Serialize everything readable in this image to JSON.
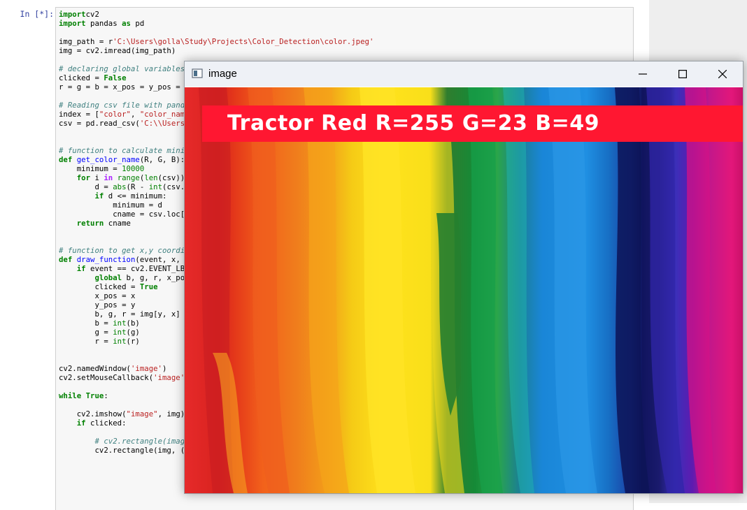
{
  "notebook": {
    "prompt": "In [*]:",
    "code_lines": [
      [
        [
          "kw",
          "import"
        ],
        [
          "",
          "cv2"
        ]
      ],
      [
        [
          "kw",
          "import"
        ],
        [
          "",
          " pandas "
        ],
        [
          "kw",
          "as"
        ],
        [
          "",
          " pd"
        ]
      ],
      [
        [
          "",
          ""
        ]
      ],
      [
        [
          "",
          "img_path = r"
        ],
        [
          "st",
          "'C:\\Users\\golla\\Study\\Projects\\Color_Detection\\color.jpeg'"
        ]
      ],
      [
        [
          "",
          "img = cv2.imread(img_path)"
        ]
      ],
      [
        [
          "",
          ""
        ]
      ],
      [
        [
          "cm",
          "# declaring global variables"
        ]
      ],
      [
        [
          "",
          "clicked = "
        ],
        [
          "kw",
          "False"
        ]
      ],
      [
        [
          "",
          "r = g = b = x_pos = y_pos = "
        ]
      ],
      [
        [
          "",
          ""
        ]
      ],
      [
        [
          "cm",
          "# Reading csv file with pand"
        ]
      ],
      [
        [
          "",
          "index = ["
        ],
        [
          "st",
          "\"color\""
        ],
        [
          "",
          ", "
        ],
        [
          "st",
          "\"color_nam"
        ]
      ],
      [
        [
          "",
          "csv = pd.read_csv("
        ],
        [
          "st",
          "'C:\\\\Users"
        ]
      ],
      [
        [
          "",
          ""
        ]
      ],
      [
        [
          "",
          ""
        ]
      ],
      [
        [
          "cm",
          "# function to calculate mini"
        ]
      ],
      [
        [
          "kw",
          "def"
        ],
        [
          "",
          " "
        ],
        [
          "fn",
          "get_color_name"
        ],
        [
          "",
          "(R, G, B):"
        ]
      ],
      [
        [
          "",
          "    minimum = "
        ],
        [
          "num",
          "10000"
        ]
      ],
      [
        [
          "",
          "    "
        ],
        [
          "kw",
          "for"
        ],
        [
          "",
          " i "
        ],
        [
          "op",
          "in"
        ],
        [
          "",
          " "
        ],
        [
          "nm",
          "range"
        ],
        [
          "",
          "("
        ],
        [
          "nm",
          "len"
        ],
        [
          "",
          "(csv))"
        ]
      ],
      [
        [
          "",
          "        d = "
        ],
        [
          "nm",
          "abs"
        ],
        [
          "",
          "(R - "
        ],
        [
          "nm",
          "int"
        ],
        [
          "",
          "(csv."
        ]
      ],
      [
        [
          "",
          "        "
        ],
        [
          "kw",
          "if"
        ],
        [
          "",
          " d <= minimum:"
        ]
      ],
      [
        [
          "",
          "            minimum = d"
        ]
      ],
      [
        [
          "",
          "            cname = csv.loc["
        ]
      ],
      [
        [
          "",
          "    "
        ],
        [
          "kw",
          "return"
        ],
        [
          "",
          " cname"
        ]
      ],
      [
        [
          "",
          ""
        ]
      ],
      [
        [
          "",
          ""
        ]
      ],
      [
        [
          "cm",
          "# function to get x,y coordi"
        ]
      ],
      [
        [
          "kw",
          "def"
        ],
        [
          "",
          " "
        ],
        [
          "fn",
          "draw_function"
        ],
        [
          "",
          "(event, x,"
        ]
      ],
      [
        [
          "",
          "    "
        ],
        [
          "kw",
          "if"
        ],
        [
          "",
          " event == cv2.EVENT_LB"
        ]
      ],
      [
        [
          "",
          "        "
        ],
        [
          "kw",
          "global"
        ],
        [
          "",
          " b, g, r, x_po"
        ]
      ],
      [
        [
          "",
          "        clicked = "
        ],
        [
          "kw",
          "True"
        ]
      ],
      [
        [
          "",
          "        x_pos = x"
        ]
      ],
      [
        [
          "",
          "        y_pos = y"
        ]
      ],
      [
        [
          "",
          "        b, g, r = img[y, x]"
        ]
      ],
      [
        [
          "",
          "        b = "
        ],
        [
          "nm",
          "int"
        ],
        [
          "",
          "(b)"
        ]
      ],
      [
        [
          "",
          "        g = "
        ],
        [
          "nm",
          "int"
        ],
        [
          "",
          "(g)"
        ]
      ],
      [
        [
          "",
          "        r = "
        ],
        [
          "nm",
          "int"
        ],
        [
          "",
          "(r)"
        ]
      ],
      [
        [
          "",
          ""
        ]
      ],
      [
        [
          "",
          ""
        ]
      ],
      [
        [
          "",
          "cv2.namedWindow("
        ],
        [
          "st",
          "'image'"
        ],
        [
          "",
          ")"
        ]
      ],
      [
        [
          "",
          "cv2.setMouseCallback("
        ],
        [
          "st",
          "'image'"
        ]
      ],
      [
        [
          "",
          ""
        ]
      ],
      [
        [
          "kw",
          "while"
        ],
        [
          "",
          " "
        ],
        [
          "kw",
          "True"
        ],
        [
          "",
          ":"
        ]
      ],
      [
        [
          "",
          ""
        ]
      ],
      [
        [
          "",
          "    cv2.imshow("
        ],
        [
          "st",
          "\"image\""
        ],
        [
          "",
          ", img)"
        ]
      ],
      [
        [
          "",
          "    "
        ],
        [
          "kw",
          "if"
        ],
        [
          "",
          " clicked:"
        ]
      ],
      [
        [
          "",
          ""
        ]
      ],
      [
        [
          "",
          "        "
        ],
        [
          "cm",
          "# cv2.rectangle(image"
        ]
      ],
      [
        [
          "",
          "        cv2.rectangle(img, ("
        ]
      ]
    ]
  },
  "window": {
    "title": "image",
    "icon": "window-app-icon",
    "buttons": [
      "minimize-icon",
      "maximize-icon",
      "close-icon"
    ]
  },
  "overlay": {
    "label": "Tractor Red R=255 G=23 B=49",
    "color": "#ff1731"
  }
}
